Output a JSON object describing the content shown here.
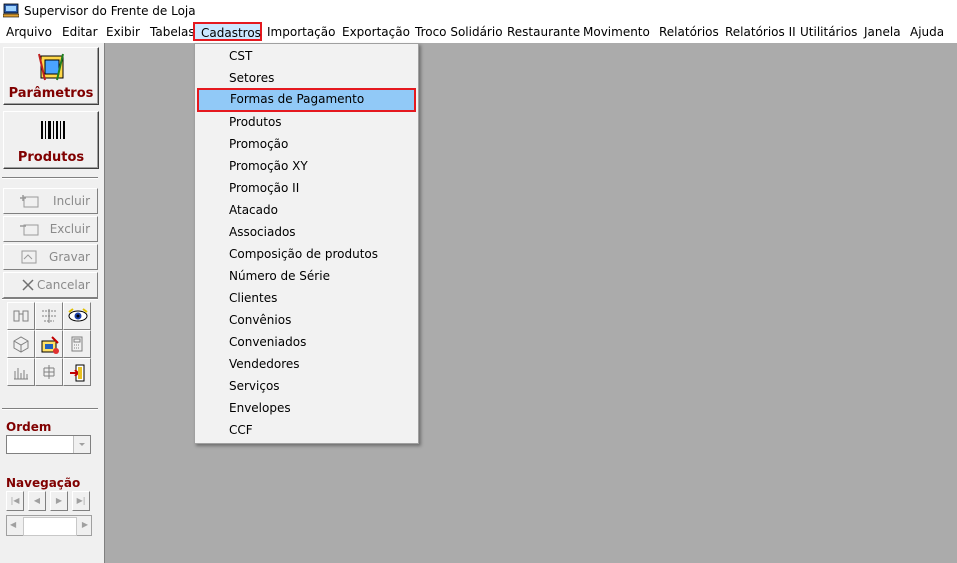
{
  "window": {
    "title": "Supervisor do Frente de Loja"
  },
  "menubar": {
    "items": [
      "Arquivo",
      "Editar",
      "Exibir",
      "Tabelas",
      "Cadastros",
      "Importação",
      "Exportação",
      "Troco Solidário",
      "Restaurante",
      "Movimento",
      "Relatórios",
      "Relatórios II",
      "Utilitários",
      "Janela",
      "Ajuda"
    ],
    "active": "Cadastros"
  },
  "sidebar": {
    "parametros_label": "Parâmetros",
    "produtos_label": "Produtos",
    "actions": [
      "Incluir",
      "Excluir",
      "Gravar",
      "Cancelar"
    ],
    "tools": [
      "binoculars-icon",
      "filter-icon",
      "eye-icon",
      "cube-icon",
      "form-icon",
      "calculator-icon",
      "bar-chart-icon",
      "tree-icon",
      "exit-door-icon"
    ],
    "ordem_label": "Ordem",
    "ordem_value": "",
    "navegacao_label": "Navegação",
    "nav_buttons": [
      "first",
      "prev",
      "next",
      "last"
    ]
  },
  "dropdown": {
    "menu": "Cadastros",
    "items": [
      "CST",
      "Setores",
      "Formas de Pagamento",
      "Produtos",
      "Promoção",
      "Promoção XY",
      "Promoção II",
      "Atacado",
      "Associados",
      "Composição de produtos",
      "Número de Série",
      "Clientes",
      "Convênios",
      "Conveniados",
      "Vendedores",
      "Serviços",
      "Envelopes",
      "CCF"
    ],
    "highlighted": "Formas de Pagamento"
  },
  "colors": {
    "highlight": "#91c9f7",
    "annotation": "#e5191f",
    "label": "#800000",
    "workspace": "#ababab"
  }
}
